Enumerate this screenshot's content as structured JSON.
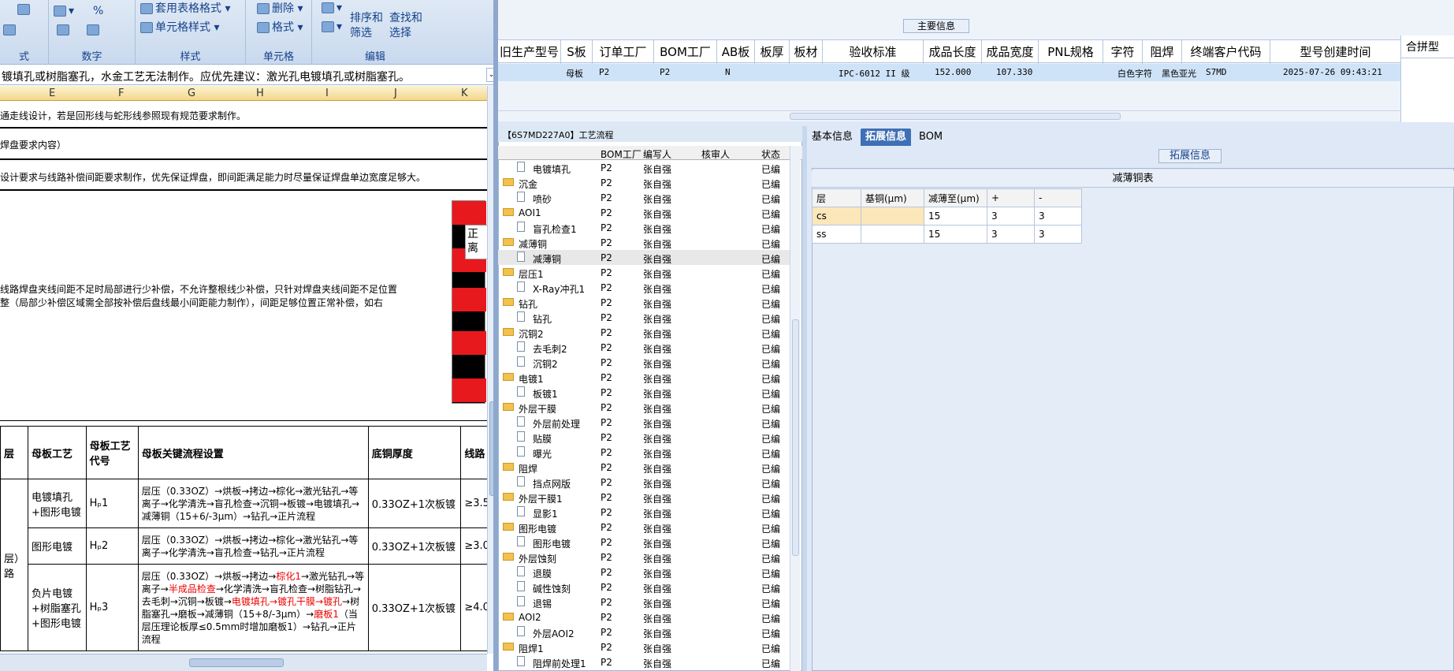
{
  "excel": {
    "ribbon": {
      "groups": [
        {
          "label": "式"
        },
        {
          "label": "数字"
        },
        {
          "label": "样式"
        },
        {
          "label": "单元格"
        },
        {
          "label": "编辑"
        }
      ],
      "buttons": {
        "table_format": "套用表格格式",
        "cell_style": "单元格样式",
        "delete": "删除",
        "format": "格式",
        "sort_filter": "排序和\n筛选",
        "find_select": "查找和\n选择",
        "percent": "%"
      }
    },
    "formula_text": "镀填孔或树脂塞孔，水金工艺无法制作。应优先建议：激光孔电镀填孔或树脂塞孔。",
    "columns": [
      "E",
      "F",
      "G",
      "H",
      "I",
      "J",
      "K"
    ],
    "lines": [
      "通走线设计，若是回形线与蛇形线参照现有规范要求制作。",
      "焊盘要求内容）",
      "设计要求与线路补偿间距要求制作，优先保证焊盘，即间距满足能力时尽量保证焊盘单边宽度足够大。",
      "线路焊盘夹线间距不足时局部进行少补偿，不允许整根线少补偿，只针对焊盘夹线间距不足位置",
      "整（局部少补偿区域需全部按补偿后盘线最小间距能力制作），间距足够位置正常补偿，如右"
    ],
    "image_note": "正\n离",
    "table": {
      "headers": [
        "层",
        "母板工艺",
        "母板工艺代号",
        "母板关键流程设置",
        "底铜厚度",
        "线路"
      ],
      "rows": [
        {
          "type": "",
          "process": "电镀填孔+图形电镀",
          "code": "Hₚ1",
          "flow": "层压（0.33OZ）→烘板→拷边→棕化→激光钻孔→等离子→化学清洗→盲孔检查→沉铜→板镀→电镀填孔→减薄铜（15+6/-3μm）→钻孔→正片流程",
          "copper": "0.33OZ+1次板镀",
          "line": "≥3.5"
        },
        {
          "type": "",
          "process": "图形电镀",
          "code": "Hₚ2",
          "flow": "层压（0.33OZ）→烘板→拷边→棕化→激光钻孔→等离子→化学清洗→盲孔检查→钻孔→正片流程",
          "copper": "0.33OZ+1次板镀",
          "line": "≥3.0"
        },
        {
          "type": "层）路",
          "process": "负片电镀+树脂塞孔+图形电镀",
          "code": "Hₚ3",
          "flow_parts": [
            "层压（0.33OZ）→烘板→拷边→",
            "棕化1",
            "→激光钻孔→等离子→",
            "半成品检查",
            "→化学清洗→盲孔检查→树脂钻孔→去毛刺→沉铜→板镀→",
            "电镀填孔→镀孔干膜→镀孔",
            "→树脂塞孔→磨板→减薄铜（15+8/-3μm）→",
            "磨板1",
            "（当层压理论板厚≤0.5mm时增加磨板1）→钻孔→正片流程"
          ],
          "copper": "0.33OZ+1次板镀",
          "line": "≥4.0"
        }
      ]
    }
  },
  "main": {
    "title": "主要信息",
    "headers": [
      "旧生产型号",
      "S板",
      "订单工厂",
      "BOM工厂",
      "AB板",
      "板厚",
      "板材",
      "验收标准",
      "成品长度",
      "成品宽度",
      "PNL规格",
      "字符",
      "阻焊",
      "终端客户代码",
      "型号创建时间"
    ],
    "row": [
      "",
      "母板",
      "P2",
      "P2",
      "N",
      "",
      "",
      "IPC-6012 II 级",
      "152.000",
      "107.330",
      "",
      "白色字符",
      "黑色亚光",
      "S7MD",
      "2025-07-26 09:43:21"
    ],
    "right_header": "合拼型"
  },
  "tree": {
    "title": "【6S7MD227A0】工艺流程",
    "headers": [
      "BOM工厂",
      "编写人",
      "核审人",
      "状态"
    ],
    "items": [
      {
        "label": "电镀填孔",
        "level": 1,
        "bom": "P2",
        "author": "张自强",
        "status": "已编"
      },
      {
        "label": "沉金",
        "level": 0,
        "bom": "P2",
        "author": "张自强",
        "status": "已编"
      },
      {
        "label": "喷砂",
        "level": 1,
        "bom": "P2",
        "author": "张自强",
        "status": "已编"
      },
      {
        "label": "AOI1",
        "level": 0,
        "bom": "P2",
        "author": "张自强",
        "status": "已编"
      },
      {
        "label": "盲孔检查1",
        "level": 1,
        "bom": "P2",
        "author": "张自强",
        "status": "已编"
      },
      {
        "label": "减薄铜",
        "level": 0,
        "bom": "P2",
        "author": "张自强",
        "status": "已编"
      },
      {
        "label": "减薄铜",
        "level": 1,
        "bom": "P2",
        "author": "张自强",
        "status": "已编",
        "selected": true
      },
      {
        "label": "层压1",
        "level": 0,
        "bom": "P2",
        "author": "张自强",
        "status": "已编"
      },
      {
        "label": "X-Ray冲孔1",
        "level": 1,
        "bom": "P2",
        "author": "张自强",
        "status": "已编"
      },
      {
        "label": "钻孔",
        "level": 0,
        "bom": "P2",
        "author": "张自强",
        "status": "已编"
      },
      {
        "label": "钻孔",
        "level": 1,
        "bom": "P2",
        "author": "张自强",
        "status": "已编"
      },
      {
        "label": "沉铜2",
        "level": 0,
        "bom": "P2",
        "author": "张自强",
        "status": "已编"
      },
      {
        "label": "去毛刺2",
        "level": 1,
        "bom": "P2",
        "author": "张自强",
        "status": "已编"
      },
      {
        "label": "沉铜2",
        "level": 1,
        "bom": "P2",
        "author": "张自强",
        "status": "已编"
      },
      {
        "label": "电镀1",
        "level": 0,
        "bom": "P2",
        "author": "张自强",
        "status": "已编"
      },
      {
        "label": "板镀1",
        "level": 1,
        "bom": "P2",
        "author": "张自强",
        "status": "已编"
      },
      {
        "label": "外层干膜",
        "level": 0,
        "bom": "P2",
        "author": "张自强",
        "status": "已编"
      },
      {
        "label": "外层前处理",
        "level": 1,
        "bom": "P2",
        "author": "张自强",
        "status": "已编"
      },
      {
        "label": "贴膜",
        "level": 1,
        "bom": "P2",
        "author": "张自强",
        "status": "已编"
      },
      {
        "label": "曝光",
        "level": 1,
        "bom": "P2",
        "author": "张自强",
        "status": "已编"
      },
      {
        "label": "阻焊",
        "level": 0,
        "bom": "P2",
        "author": "张自强",
        "status": "已编"
      },
      {
        "label": "挡点网版",
        "level": 1,
        "bom": "P2",
        "author": "张自强",
        "status": "已编"
      },
      {
        "label": "外层干膜1",
        "level": 0,
        "bom": "P2",
        "author": "张自强",
        "status": "已编"
      },
      {
        "label": "显影1",
        "level": 1,
        "bom": "P2",
        "author": "张自强",
        "status": "已编"
      },
      {
        "label": "图形电镀",
        "level": 0,
        "bom": "P2",
        "author": "张自强",
        "status": "已编"
      },
      {
        "label": "图形电镀",
        "level": 1,
        "bom": "P2",
        "author": "张自强",
        "status": "已编"
      },
      {
        "label": "外层蚀刻",
        "level": 0,
        "bom": "P2",
        "author": "张自强",
        "status": "已编"
      },
      {
        "label": "退膜",
        "level": 1,
        "bom": "P2",
        "author": "张自强",
        "status": "已编"
      },
      {
        "label": "碱性蚀刻",
        "level": 1,
        "bom": "P2",
        "author": "张自强",
        "status": "已编"
      },
      {
        "label": "退锡",
        "level": 1,
        "bom": "P2",
        "author": "张自强",
        "status": "已编"
      },
      {
        "label": "AOI2",
        "level": 0,
        "bom": "P2",
        "author": "张自强",
        "status": "已编"
      },
      {
        "label": "外层AOI2",
        "level": 1,
        "bom": "P2",
        "author": "张自强",
        "status": "已编"
      },
      {
        "label": "阻焊1",
        "level": 0,
        "bom": "P2",
        "author": "张自强",
        "status": "已编"
      },
      {
        "label": "阻焊前处理1",
        "level": 1,
        "bom": "P2",
        "author": "张自强",
        "status": "已编"
      }
    ]
  },
  "detail": {
    "tabs": [
      "基本信息",
      "拓展信息",
      "BOM"
    ],
    "active_tab": "拓展信息",
    "section_title": "拓展信息",
    "table_title": "减薄铜表",
    "columns": [
      "层",
      "基铜(μm)",
      "减薄至(μm)",
      "+",
      "-"
    ],
    "rows": [
      [
        "cs",
        "",
        "15",
        "3",
        "3"
      ],
      [
        "ss",
        "",
        "15",
        "3",
        "3"
      ]
    ]
  },
  "colors": {
    "accent": "#3f6fb5",
    "selected_row": "#cfe3f8",
    "folder": "#f2c14e",
    "red_text": "#e00000"
  }
}
